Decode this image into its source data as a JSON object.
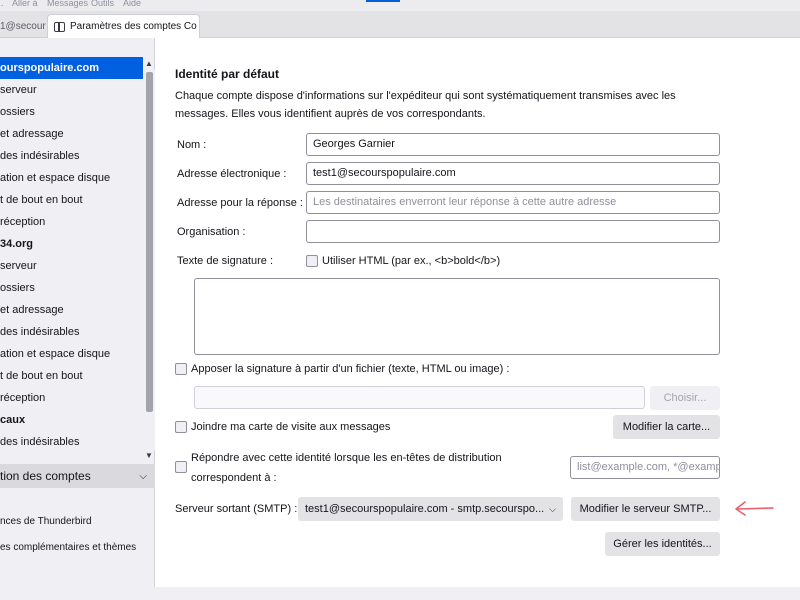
{
  "menubar": {
    "items": [
      "...",
      "Aller à",
      "Messages",
      "Outils",
      "Aide"
    ]
  },
  "tabs": {
    "inactive": "1@secour",
    "active": "Paramètres des comptes Co"
  },
  "sidebar": {
    "items": [
      {
        "label": "ourspopulaire.com",
        "bold": true,
        "selected": true
      },
      {
        "label": "serveur"
      },
      {
        "label": "ossiers"
      },
      {
        "label": "et adressage"
      },
      {
        "label": "des indésirables"
      },
      {
        "label": "ation et espace disque"
      },
      {
        "label": "t de bout en bout"
      },
      {
        "label": "réception"
      },
      {
        "label": "34.org",
        "bold": true
      },
      {
        "label": "serveur"
      },
      {
        "label": "ossiers"
      },
      {
        "label": "et adressage"
      },
      {
        "label": "des indésirables"
      },
      {
        "label": "ation et espace disque"
      },
      {
        "label": "t de bout en bout"
      },
      {
        "label": "réception"
      },
      {
        "label": "caux",
        "bold": true
      },
      {
        "label": "des indésirables"
      }
    ],
    "account_actions": "tion des comptes",
    "links": [
      "nces de Thunderbird",
      "es complémentaires et thèmes"
    ]
  },
  "identity": {
    "section_title": "Identité par défaut",
    "description": "Chaque compte dispose d'informations sur l'expéditeur qui sont systématiquement transmises avec les messages. Elles vous identifient auprès de vos correspondants.",
    "name_label": "Nom :",
    "name_value": "Georges Garnier",
    "email_label": "Adresse électronique :",
    "email_value": "test1@secourspopulaire.com",
    "reply_label": "Adresse pour la réponse :",
    "reply_placeholder": "Les destinataires enverront leur réponse à cette autre adresse",
    "org_label": "Organisation :",
    "org_value": "",
    "signature_label": "Texte de signature :",
    "use_html_label": "Utiliser HTML (par ex., <b>bold</b>)",
    "attach_sig_label": "Apposer la signature à partir d'un fichier (texte, HTML ou image) :",
    "choose_button": "Choisir...",
    "vcard_label": "Joindre ma carte de visite aux messages",
    "edit_card_button": "Modifier la carte...",
    "reply_headers_line1": "Répondre avec cette identité lorsque les en-têtes de distribution",
    "reply_headers_line2": "correspondent à :",
    "reply_headers_placeholder": "list@example.com, *@example.com",
    "smtp_label": "Serveur sortant (SMTP) :",
    "smtp_value": "test1@secourspopulaire.com - smtp.secourspo...",
    "edit_smtp_button": "Modifier le serveur SMTP...",
    "manage_identities_button": "Gérer les identités..."
  },
  "annotation": {
    "arrow_color": "#e8606a"
  }
}
